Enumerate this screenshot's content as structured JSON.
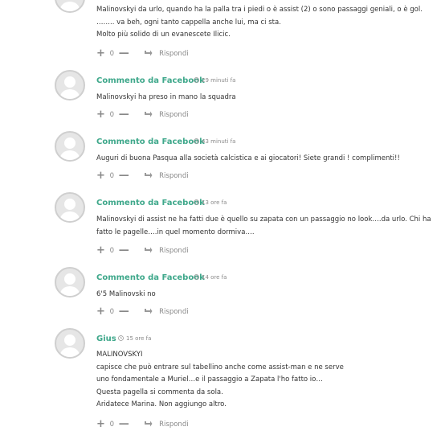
{
  "comments": [
    {
      "author": "",
      "time": "",
      "lines": [
        "Malinovskyi da urlo, quando ha la palla tra i piedi o è assist (2) o sono passaggi geniali, o è gol.",
        "…….. va beh, ogni tanto cappella anche lui, ma ci sta.",
        "Molto più solido di un evanescete Ilicic."
      ],
      "votes": "0",
      "reply": "Rispondi"
    },
    {
      "author": "Commento da Facebook",
      "time": "29 minuti fa",
      "lines": [
        "Malinovskyi ha preso in mano la squadra"
      ],
      "votes": "0",
      "reply": "Rispondi"
    },
    {
      "author": "Commento da Facebook",
      "time": "43 minuti fa",
      "lines": [
        "Auguri di buona Pasqua alla società calcistica e ai giocatori! Siete grandi ! complimenti!!"
      ],
      "votes": "0",
      "reply": "Rispondi"
    },
    {
      "author": "Commento da Facebook",
      "time": "13 ore fa",
      "lines": [
        "Malinovskyi di assist ne ha fatti due è quello su zapata con un passaggio no look….da urlo. Chi ha",
        "fatto le pagelle….in quel momento dormiva…."
      ],
      "votes": "0",
      "reply": "Rispondi"
    },
    {
      "author": "Commento da Facebook",
      "time": "14 ore fa",
      "lines": [
        "6'5 Malinovski no"
      ],
      "votes": "0",
      "reply": "Rispondi"
    },
    {
      "author": "Gius",
      "time": "15 ore fa",
      "lines": [
        "MALINOVSKYI",
        "capisce che può entrare sul tabellino anche come assist-man e ne serve",
        "uno fondamentale a Muriel…e il passaggio a Zapata l'ho fatto io…",
        "Questa pagella si commenta da sola.",
        "Aridatece Marina. Non aggiungo altro."
      ],
      "votes": "0",
      "reply": "Rispondi"
    }
  ]
}
